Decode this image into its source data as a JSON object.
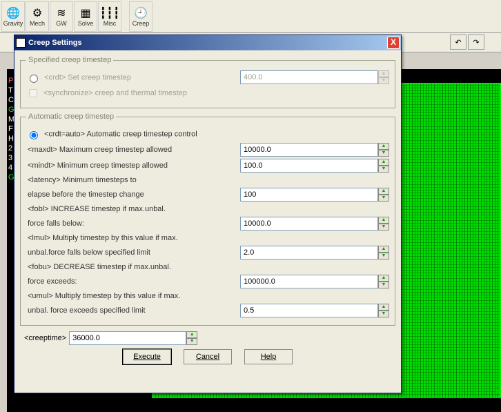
{
  "toolbar": {
    "items": [
      {
        "icon": "🌐",
        "label": "Gravity"
      },
      {
        "icon": "⚙",
        "label": "Mech"
      },
      {
        "icon": "≋",
        "label": "GW"
      },
      {
        "icon": "▦",
        "label": "Solve"
      },
      {
        "icon": "┇┇┇",
        "label": "Misc"
      },
      {
        "icon": "",
        "label": ""
      },
      {
        "icon": "🕘",
        "label": "Creep"
      }
    ]
  },
  "dialog": {
    "title": "Creep Settings",
    "group1": {
      "legend": "Specified creep timestep",
      "radio_label": "<crdt> Set creep timestep",
      "radio_value": "400.0",
      "sync_label": "<synchronize> creep and thermal timestep"
    },
    "group2": {
      "legend": "Automatic creep timestep",
      "radio_label": "<crdt=auto> Automatic creep timestep control",
      "maxdt_label": "<maxdt> Maximum creep timestep allowed",
      "maxdt_val": "10000.0",
      "mindt_label": "<mindt> Minimum creep timestep allowed",
      "mindt_val": "100.0",
      "latency_label1": "<latency> Minimum timesteps to",
      "latency_label2": "elapse before the timestep change",
      "latency_val": "100",
      "fobl_label1": "<fobl> INCREASE timestep if max.unbal.",
      "fobl_label2": "force falls below:",
      "fobl_val": "10000.0",
      "lmul_label1": "<lmul> Multiply timestep by this value if max.",
      "lmul_label2": "unbal.force falls below specified limit",
      "lmul_val": "2.0",
      "fobu_label1": "<fobu> DECREASE timestep if max.unbal.",
      "fobu_label2": "force exceeds:",
      "fobu_val": "100000.0",
      "umul_label1": "<umul> Multiply timestep by this value if max.",
      "umul_label2": "unbal. force exceeds specified limit",
      "umul_val": "0.5"
    },
    "creeptime_label": "<creeptime>",
    "creeptime_val": "36000.0",
    "buttons": {
      "execute": "Execute",
      "cancel": "Cancel",
      "help": "Help"
    }
  },
  "side": [
    "P",
    "T",
    "C",
    "G",
    "M",
    "F",
    "H",
    "2",
    "3",
    "4",
    "G"
  ]
}
